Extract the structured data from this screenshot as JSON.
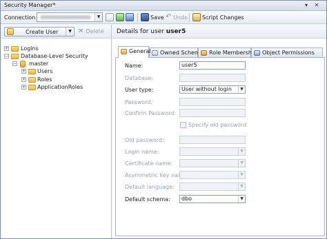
{
  "window": {
    "title": "Security Manager*"
  },
  "toolbar": {
    "connection_label": "Connection",
    "save_label": "Save",
    "undo_label": "Undo",
    "script_changes_label": "Script Changes"
  },
  "left_panel": {
    "create_user_label": "Create User",
    "delete_label": "Delete",
    "tree": {
      "logins": "Logins",
      "database_level_security": "Database-Level Security",
      "master": "master",
      "users": "Users",
      "roles": "Roles",
      "application_roles": "ApplicationRoles"
    }
  },
  "details": {
    "header_prefix": "Details for user ",
    "header_user": "user5",
    "tabs": [
      {
        "label": "General"
      },
      {
        "label": "Owned Schemas"
      },
      {
        "label": "Role Membership"
      },
      {
        "label": "Object Permissions"
      }
    ],
    "fields": {
      "name_label": "Name:",
      "name_value": "user5",
      "database_label": "Database:",
      "database_value": "",
      "user_type_label": "User type:",
      "user_type_value": "User without login",
      "password_label": "Password:",
      "confirm_password_label": "Confirm Password:",
      "specify_old_password_label": "Specify old password",
      "old_password_label": "Old password:",
      "login_name_label": "Login name:",
      "certificate_name_label": "Certificate name:",
      "asymmetric_key_name_label": "Asymmetric key name:",
      "default_language_label": "Default language:",
      "default_schema_label": "Default schema:",
      "default_schema_value": "dbo"
    }
  },
  "icons": {
    "window_controls": [
      "pin-icon",
      "close-icon"
    ],
    "toolbar": [
      "refresh-icon",
      "save-icon",
      "undo-icon",
      "script-icon"
    ],
    "tree": [
      "folder-icon",
      "database-icon",
      "users-icon"
    ]
  },
  "colors": {
    "accent": "#2a5ea8",
    "tab_border": "#a6b2c3"
  }
}
